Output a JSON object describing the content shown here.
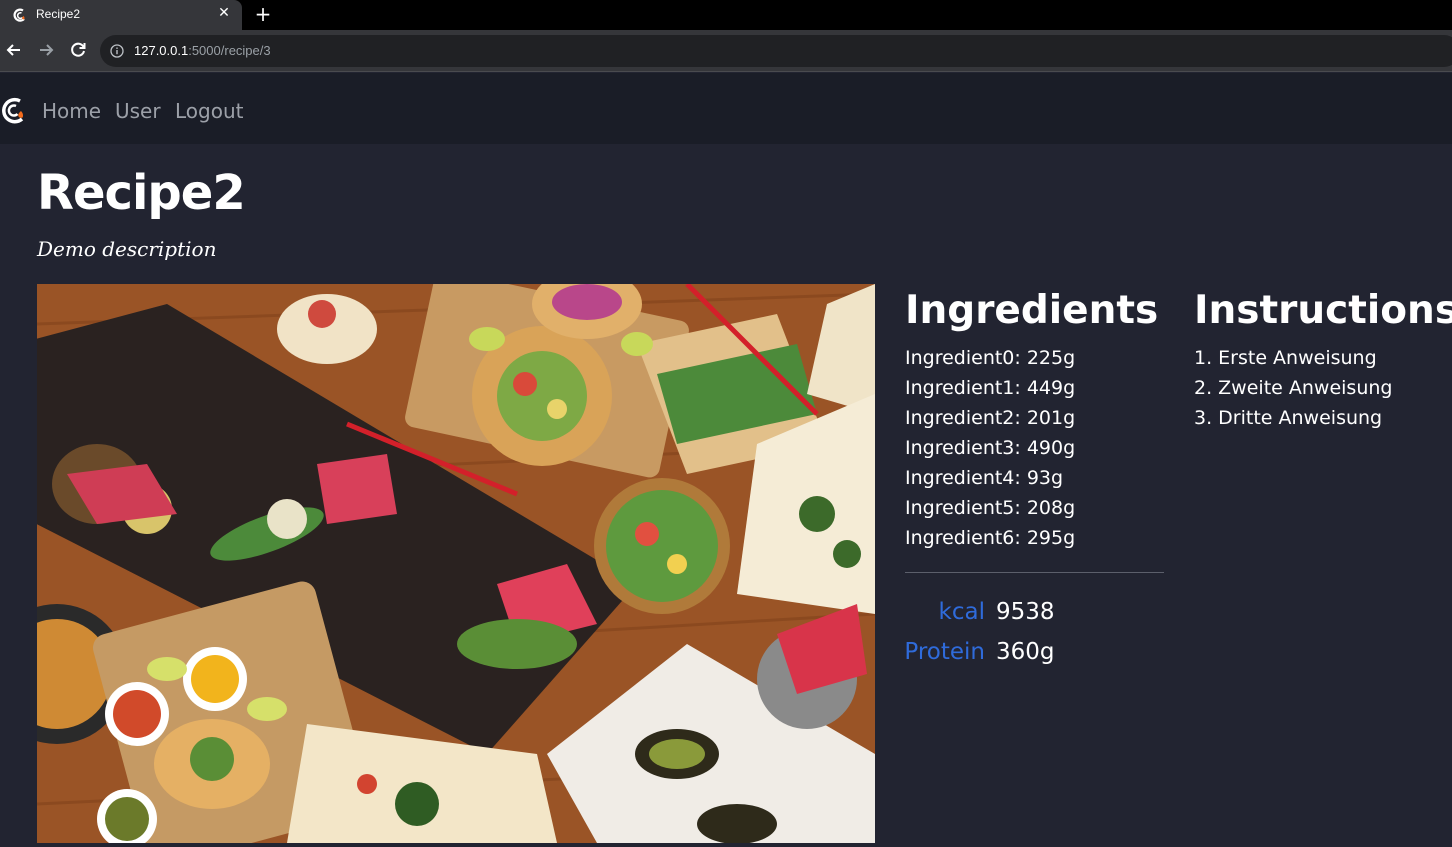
{
  "browser": {
    "tab_title": "Recipe2",
    "close_glyph": "✕",
    "new_tab_glyph": "+",
    "url_host": "127.0.0.1",
    "url_path": ":5000/recipe/3"
  },
  "navbar": {
    "links": [
      "Home",
      "User",
      "Logout"
    ]
  },
  "recipe": {
    "title": "Recipe2",
    "description": "Demo description",
    "ingredients_heading": "Ingredients",
    "ingredients": [
      "Ingredient0: 225g",
      "Ingredient1: 449g",
      "Ingredient2: 201g",
      "Ingredient3: 490g",
      "Ingredient4: 93g",
      "Ingredient5: 208g",
      "Ingredient6: 295g"
    ],
    "nutrition": {
      "kcal_label": "kcal",
      "kcal_value": "9538",
      "protein_label": "Protein",
      "protein_value": "360g"
    },
    "instructions_heading": "Instructions",
    "instructions": [
      "1. Erste Anweisung",
      "2. Zweite Anweisung",
      "3. Dritte Anweisung"
    ]
  },
  "colors": {
    "page_bg": "#222431",
    "navbar_bg": "#1a1d27",
    "accent_blue": "#2f6bdb",
    "nav_link": "#9ca0a8"
  },
  "icons": [
    "back-arrow-icon",
    "forward-arrow-icon",
    "reload-icon",
    "info-icon",
    "site-logo-icon",
    "favicon-icon"
  ]
}
